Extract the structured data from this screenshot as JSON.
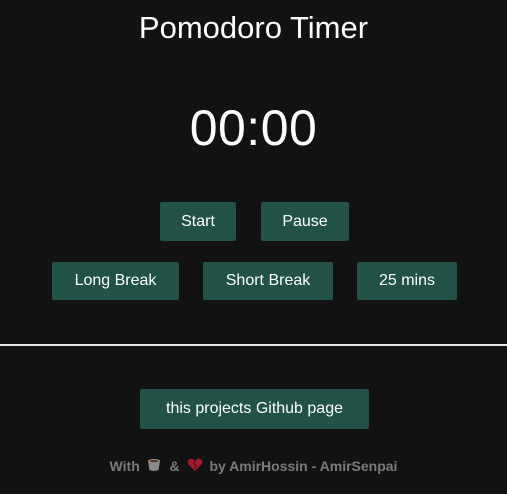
{
  "app": {
    "title": "Pomodoro Timer"
  },
  "timer": {
    "display": "00:00"
  },
  "controls": {
    "start_label": "Start",
    "pause_label": "Pause"
  },
  "modes": {
    "long_break_label": "Long Break",
    "short_break_label": "Short Break",
    "pomodoro_label": "25 mins"
  },
  "links": {
    "github_label": "this projects Github page"
  },
  "footer": {
    "prefix": "With",
    "coffee_icon": "coffee-icon",
    "conjunction": "&",
    "heart_icon": "heart-icon",
    "suffix": "by AmirHossin - AmirSenpai"
  },
  "colors": {
    "background": "#121212",
    "button": "#225147",
    "text": "#ffffff",
    "footer_text": "#7a7a7a",
    "divider": "#e8e8e8"
  }
}
